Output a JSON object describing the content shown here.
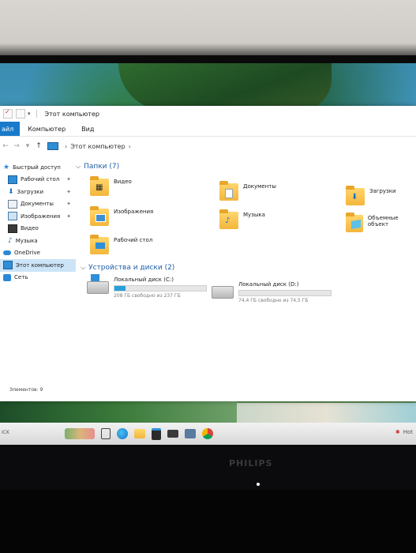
{
  "window": {
    "title": "Этот компьютер",
    "ribbon": {
      "file_tab": "айл",
      "tabs": [
        "Компьютер",
        "Вид"
      ]
    },
    "address": {
      "path": "Этот компьютер"
    },
    "sidebar": {
      "items": [
        {
          "label": "Быстрый доступ",
          "icon": "star-icon"
        },
        {
          "label": "Рабочий стол",
          "icon": "desktop-folder-icon",
          "pinned": true
        },
        {
          "label": "Загрузки",
          "icon": "download-arrow-icon",
          "pinned": true
        },
        {
          "label": "Документы",
          "icon": "documents-icon",
          "pinned": true
        },
        {
          "label": "Изображения",
          "icon": "pictures-icon",
          "pinned": true
        },
        {
          "label": "Видео",
          "icon": "video-icon"
        },
        {
          "label": "Музыка",
          "icon": "music-note-icon"
        },
        {
          "label": "OneDrive",
          "icon": "cloud-icon"
        },
        {
          "label": "Этот компьютер",
          "icon": "computer-icon",
          "selected": true
        },
        {
          "label": "Сеть",
          "icon": "network-icon"
        }
      ]
    },
    "folders_group": {
      "label": "Папки (7)"
    },
    "folders": [
      {
        "label": "Видео",
        "icon": "video-folder-icon"
      },
      {
        "label": "Документы",
        "icon": "documents-folder-icon"
      },
      {
        "label": "Загрузки",
        "icon": "downloads-folder-icon"
      },
      {
        "label": "Изображения",
        "icon": "pictures-folder-icon"
      },
      {
        "label": "Музыка",
        "icon": "music-folder-icon"
      },
      {
        "label": "Объемные объект",
        "icon": "3d-objects-folder-icon"
      },
      {
        "label": "Рабочий стол",
        "icon": "desktop-folder-icon"
      }
    ],
    "devices_group": {
      "label": "Устройства и диски (2)"
    },
    "drives": [
      {
        "label": "Локальный диск (C:)",
        "free_text": "208 ГБ свободно из 237 ГБ",
        "used_fraction": 0.12
      },
      {
        "label": "Локальный диск (D:)",
        "free_text": "74,4 ГБ свободно из 74,5 ГБ",
        "used_fraction": 0.0
      }
    ],
    "status": "Элементов: 9"
  },
  "taskbar": {
    "left_text": "ICK",
    "tray_text": "Hot",
    "icons": [
      "search-box",
      "task-view-icon",
      "edge-icon",
      "file-explorer-icon",
      "store-icon",
      "mail-icon",
      "photos-icon",
      "chrome-icon"
    ]
  },
  "monitor": {
    "brand": "PHILIPS"
  },
  "colors": {
    "accent": "#1979ca",
    "selection": "#cce4f7",
    "drive_bar": "#26a0da",
    "group_header": "#1f5ea8"
  }
}
